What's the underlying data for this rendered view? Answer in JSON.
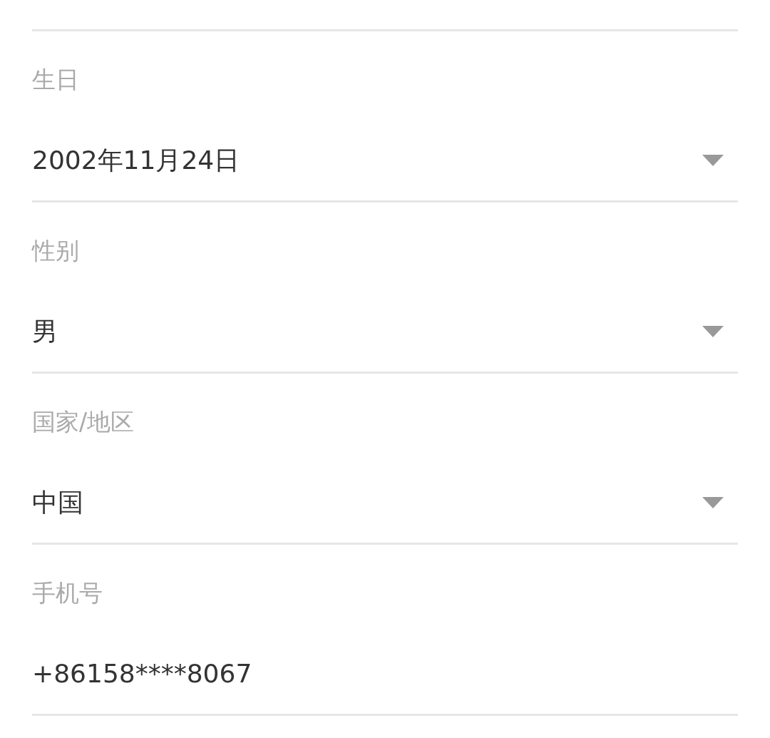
{
  "fields": [
    {
      "label": "生日",
      "value": "2002年11月24日",
      "kind": "dropdown"
    },
    {
      "label": "性别",
      "value": "男",
      "kind": "dropdown"
    },
    {
      "label": "国家/地区",
      "value": "中国",
      "kind": "dropdown"
    },
    {
      "label": "手机号",
      "value": "+86158****8067",
      "kind": "text"
    }
  ]
}
